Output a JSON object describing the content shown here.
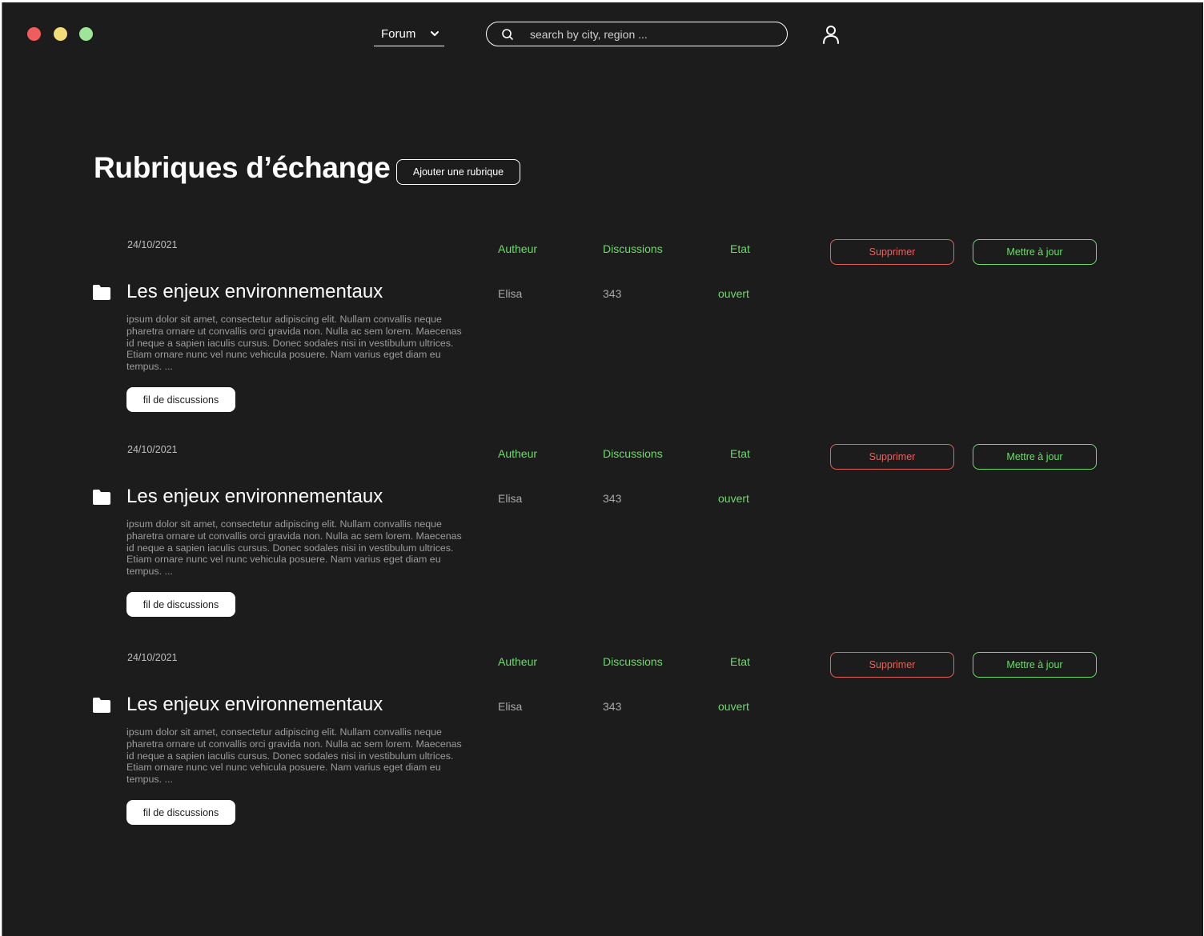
{
  "colors": {
    "background": "#1c1c1c",
    "accent_green": "#6ddc6d",
    "danger_red": "#e2645e",
    "window_red": "#f25c5c",
    "window_yellow": "#f3dd7a",
    "window_green": "#9de597"
  },
  "header": {
    "nav_select": "Forum",
    "search_placeholder": "search by city, region ..."
  },
  "main": {
    "title": "Rubriques d’échange",
    "add_button": "Ajouter une rubrique"
  },
  "topics": [
    {
      "date": "24/10/2021",
      "title": "Les enjeux environnementaux",
      "description": "ipsum dolor sit amet, consectetur adipiscing elit. Nullam convallis neque pharetra ornare ut convallis orci gravida non. Nulla ac sem lorem. Maecenas id neque a sapien iaculis cursus. Donec sodales nisi in vestibulum ultrices. Etiam ornare nunc vel nunc vehicula posuere. Nam varius eget diam eu tempus.  ...",
      "thread_button": "fil de discussions",
      "author_label": "Autheur",
      "discussions_label": "Discussions",
      "state_label": "Etat",
      "author": "Elisa",
      "discussions": "343",
      "state": "ouvert",
      "delete_button": "Supprimer",
      "update_button": "Mettre à jour"
    },
    {
      "date": "24/10/2021",
      "title": "Les enjeux environnementaux",
      "description": "ipsum dolor sit amet, consectetur adipiscing elit. Nullam convallis neque pharetra ornare ut convallis orci gravida non. Nulla ac sem lorem. Maecenas id neque a sapien iaculis cursus. Donec sodales nisi in vestibulum ultrices. Etiam ornare nunc vel nunc vehicula posuere. Nam varius eget diam eu tempus.  ...",
      "thread_button": "fil de discussions",
      "author_label": "Autheur",
      "discussions_label": "Discussions",
      "state_label": "Etat",
      "author": "Elisa",
      "discussions": "343",
      "state": "ouvert",
      "delete_button": "Supprimer",
      "update_button": "Mettre à jour"
    },
    {
      "date": "24/10/2021",
      "title": "Les enjeux environnementaux",
      "description": "ipsum dolor sit amet, consectetur adipiscing elit. Nullam convallis neque pharetra ornare ut convallis orci gravida non. Nulla ac sem lorem. Maecenas id neque a sapien iaculis cursus. Donec sodales nisi in vestibulum ultrices. Etiam ornare nunc vel nunc vehicula posuere. Nam varius eget diam eu tempus.  ...",
      "thread_button": "fil de discussions",
      "author_label": "Autheur",
      "discussions_label": "Discussions",
      "state_label": "Etat",
      "author": "Elisa",
      "discussions": "343",
      "state": "ouvert",
      "delete_button": "Supprimer",
      "update_button": "Mettre à jour"
    }
  ]
}
